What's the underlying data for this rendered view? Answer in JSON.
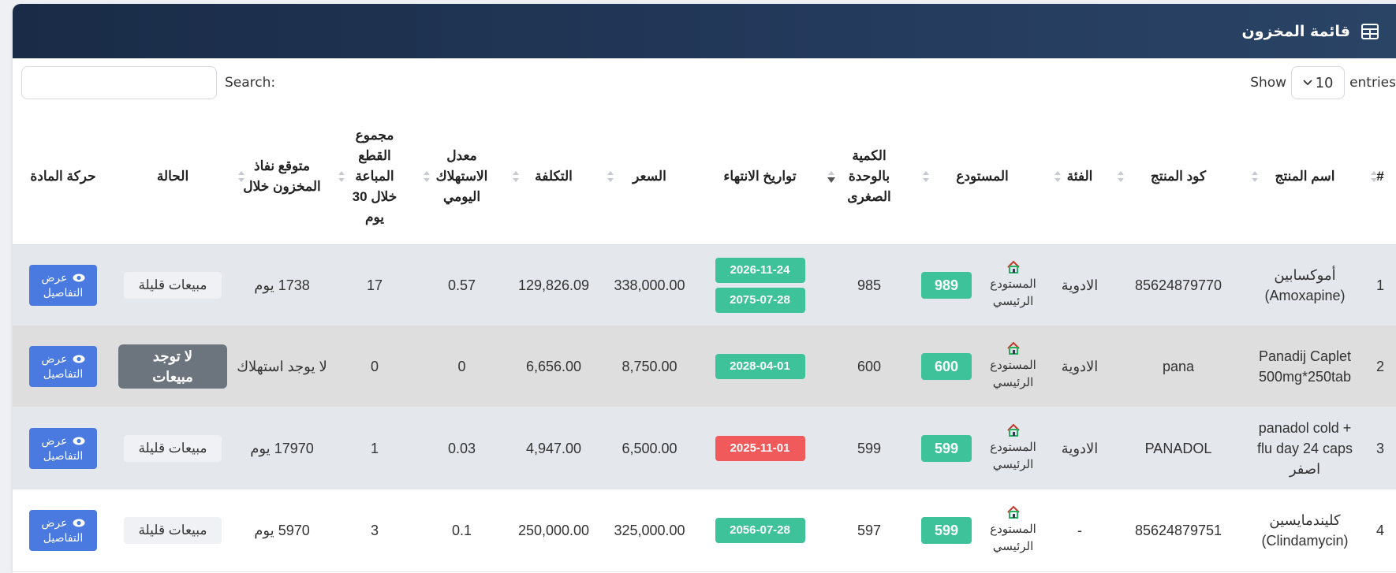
{
  "header": {
    "title": "قائمة المخزون"
  },
  "controls": {
    "show_label": "Show",
    "entries_value": "10",
    "entries_label": "entries",
    "search_label": "Search:",
    "search_value": ""
  },
  "columns": [
    "#",
    "اسم المنتج",
    "كود المنتج",
    "الفئة",
    "المستودع",
    "الكمية بالوحدة الصغرى",
    "تواريخ الانتهاء",
    "السعر",
    "التكلفة",
    "معدل الاستهلاك اليومي",
    "مجموع القطع المباعة خلال 30 يوم",
    "متوقع نفاذ المخزون خلال",
    "الحالة",
    "حركة المادة"
  ],
  "rows": [
    {
      "num": "1",
      "name": "أموكسابين (Amoxapine)",
      "code": "85624879770",
      "category": "الادوية",
      "warehouse": "المستودع الرئيسي",
      "warehouse_qty": "989",
      "qty_small": "985",
      "expiry1": "2026-11-24",
      "expiry2": "2075-07-28",
      "price": "338,000.00",
      "cost": "129,826.09",
      "daily_rate": "0.57",
      "sold_30": "17",
      "depletion": "1738 يوم",
      "status": "مبيعات قليلة",
      "action": {
        "top": "عرض",
        "bottom": "التفاصيل"
      }
    },
    {
      "num": "2",
      "name": "Panadij Caplet 500mg*250tab",
      "code": "pana",
      "category": "الادوية",
      "warehouse": "المستودع الرئيسي",
      "warehouse_qty": "600",
      "qty_small": "600",
      "expiry1": "2028-04-01",
      "price": "8,750.00",
      "cost": "6,656.00",
      "daily_rate": "0",
      "sold_30": "0",
      "depletion": "لا يوجد استهلاك",
      "status": "لا توجد مبيعات",
      "action": {
        "top": "عرض",
        "bottom": "التفاصيل"
      }
    },
    {
      "num": "3",
      "name": "panadol cold + flu day 24 caps اصفر",
      "code": "PANADOL",
      "category": "الادوية",
      "warehouse": "المستودع الرئيسي",
      "warehouse_qty": "599",
      "qty_small": "599",
      "expiry1": "2025-11-01",
      "price": "6,500.00",
      "cost": "4,947.00",
      "daily_rate": "0.03",
      "sold_30": "1",
      "depletion": "17970 يوم",
      "status": "مبيعات قليلة",
      "action": {
        "top": "عرض",
        "bottom": "التفاصيل"
      }
    },
    {
      "num": "4",
      "name": "كليندمايسين (Clindamycin)",
      "code": "85624879751",
      "category": "-",
      "warehouse": "المستودع الرئيسي",
      "warehouse_qty": "599",
      "qty_small": "597",
      "expiry1": "2056-07-28",
      "price": "325,000.00",
      "cost": "250,000.00",
      "daily_rate": "0.1",
      "sold_30": "3",
      "depletion": "5970 يوم",
      "status": "مبيعات قليلة",
      "action": {
        "top": "عرض",
        "bottom": "التفاصيل"
      }
    }
  ],
  "colors": {
    "header_bg": "#1f3352",
    "badge_green": "#3ec29a",
    "badge_red": "#f05a5a",
    "button_blue": "#4a79e0",
    "status_dark": "#6c757d"
  },
  "icons": [
    "table-icon",
    "chevron-down-icon",
    "sort-icon",
    "home-icon",
    "eye-icon"
  ]
}
